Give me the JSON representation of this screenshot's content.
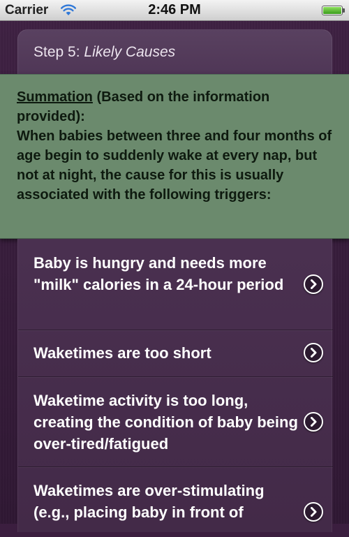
{
  "status_bar": {
    "carrier": "Carrier",
    "time": "2:46 PM",
    "wifi_icon": "wifi-icon",
    "battery_icon": "battery-icon"
  },
  "step": {
    "prefix": "Step 5: ",
    "name": "Likely Causes"
  },
  "summation": {
    "label": "Summation",
    "qualifier": " (Based on the information provided):",
    "body": "When babies between three and four months of age begin to suddenly wake at every nap, but not at night, the cause for this is usually associated with the following triggers:"
  },
  "causes": [
    {
      "label": "Baby is hungry and needs more \"milk\" calories in a 24-hour period",
      "icon": "chevron-right-icon"
    },
    {
      "label": "Waketimes are too short",
      "icon": "chevron-right-icon"
    },
    {
      "label": "Waketime activity is too long, creating the condition of baby being over-tired/fatigued",
      "icon": "chevron-right-icon"
    },
    {
      "label": "Waketimes are over-stimulating (e.g., placing baby in front of",
      "icon": "chevron-right-icon"
    }
  ],
  "colors": {
    "background": "#3b1e3f",
    "summation_bg": "#6b8a6d",
    "list_bg": "#4a3050",
    "text_light": "#ffffff"
  }
}
